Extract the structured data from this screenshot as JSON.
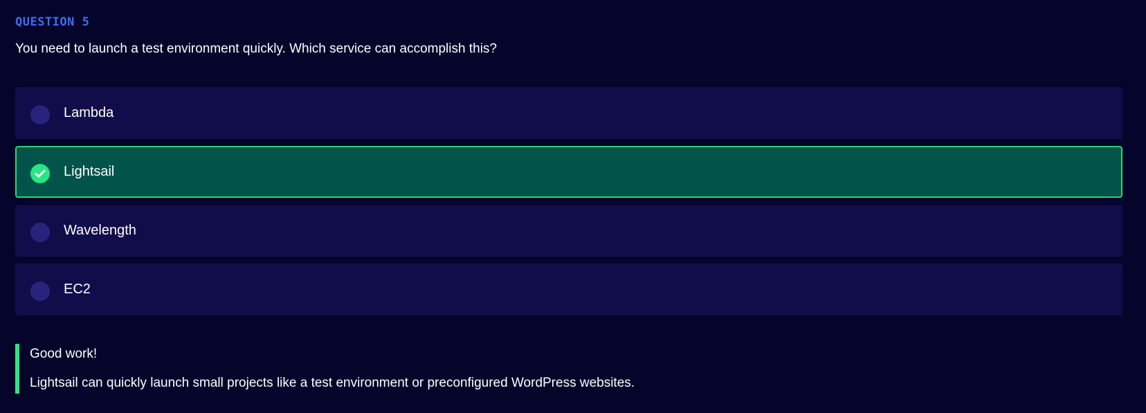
{
  "question": {
    "label": "QUESTION 5",
    "text": "You need to launch a test environment quickly. Which service can accomplish this?"
  },
  "options": [
    {
      "label": "Lambda",
      "selected": false
    },
    {
      "label": "Lightsail",
      "selected": true
    },
    {
      "label": "Wavelength",
      "selected": false
    },
    {
      "label": "EC2",
      "selected": false
    }
  ],
  "feedback": {
    "title": "Good work!",
    "text": "Lightsail can quickly launch small projects like a test environment or preconfigured WordPress websites."
  },
  "colors": {
    "background": "#05042a",
    "question_label": "#3f6df2",
    "option_background": "#110d4a",
    "selected_background": "#02544a",
    "selected_border": "#2fd17c",
    "success_accent": "#25e884",
    "radio_unselected": "#2a237e"
  },
  "icons": {
    "selected_option": "check-circle-icon",
    "unselected_option": "radio-circle-icon"
  }
}
